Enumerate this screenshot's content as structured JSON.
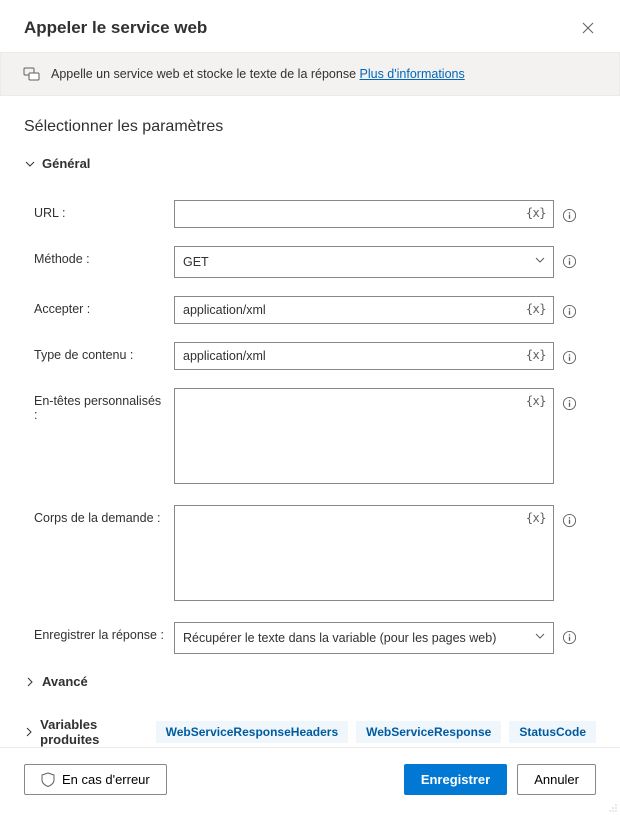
{
  "header": {
    "title": "Appeler le service web"
  },
  "infoBar": {
    "text": "Appelle un service web et stocke le texte de la réponse ",
    "link": "Plus d'informations"
  },
  "sectionTitle": "Sélectionner les paramètres",
  "general": {
    "header": "Général",
    "fields": {
      "url": {
        "label": "URL :",
        "value": ""
      },
      "method": {
        "label": "Méthode :",
        "value": "GET"
      },
      "accept": {
        "label": "Accepter :",
        "value": "application/xml"
      },
      "contentType": {
        "label": "Type de contenu :",
        "value": "application/xml"
      },
      "customHeaders": {
        "label": "En-têtes personnalisés :",
        "value": ""
      },
      "requestBody": {
        "label": "Corps de la demande :",
        "value": ""
      },
      "saveResponse": {
        "label": "Enregistrer la réponse :",
        "value": "Récupérer le texte dans la variable (pour les pages web)"
      }
    }
  },
  "advanced": {
    "header": "Avancé"
  },
  "variables": {
    "header": "Variables produites",
    "tags": [
      "WebServiceResponseHeaders",
      "WebServiceResponse",
      "StatusCode"
    ]
  },
  "footer": {
    "onError": "En cas d'erreur",
    "save": "Enregistrer",
    "cancel": "Annuler"
  },
  "icons": {
    "variableToken": "{x}"
  }
}
